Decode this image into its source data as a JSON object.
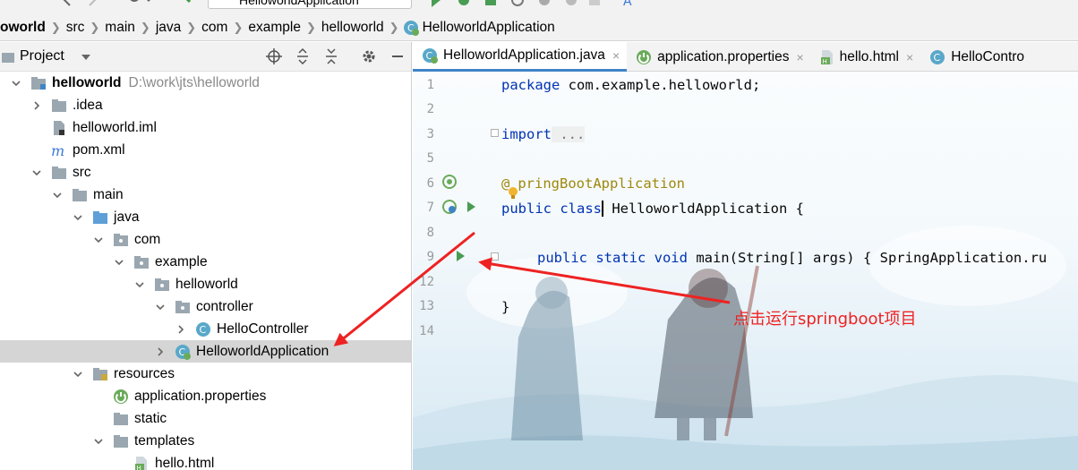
{
  "toolbar": {
    "run_config": "HelloworldApplication"
  },
  "breadcrumb": [
    "oworld",
    "src",
    "main",
    "java",
    "com",
    "example",
    "helloworld",
    "HelloworldApplication"
  ],
  "project_panel": {
    "title": "Project"
  },
  "tree": [
    {
      "label": "helloworld",
      "path": "D:\\work\\jts\\helloworld",
      "bold": true,
      "icon": "module-folder-icon",
      "expand": "down",
      "depth": 0
    },
    {
      "label": ".idea",
      "icon": "folder-icon",
      "expand": "right",
      "depth": 1
    },
    {
      "label": "helloworld.iml",
      "icon": "iml-file-icon",
      "expand": "none",
      "depth": 1
    },
    {
      "label": "pom.xml",
      "icon": "maven-icon",
      "expand": "none",
      "depth": 1
    },
    {
      "label": "src",
      "icon": "folder-icon",
      "expand": "down",
      "depth": 1
    },
    {
      "label": "main",
      "icon": "folder-icon",
      "expand": "down",
      "depth": 2
    },
    {
      "label": "java",
      "icon": "source-folder-icon",
      "expand": "down",
      "depth": 3
    },
    {
      "label": "com",
      "icon": "package-icon",
      "expand": "down",
      "depth": 4
    },
    {
      "label": "example",
      "icon": "package-icon",
      "expand": "down",
      "depth": 5
    },
    {
      "label": "helloworld",
      "icon": "package-icon",
      "expand": "down",
      "depth": 6
    },
    {
      "label": "controller",
      "icon": "package-icon",
      "expand": "down",
      "depth": 7
    },
    {
      "label": "HelloController",
      "icon": "class-icon",
      "expand": "right",
      "depth": 8
    },
    {
      "label": "HelloworldApplication",
      "icon": "spring-class-icon",
      "expand": "right",
      "depth": 7,
      "selected": true
    },
    {
      "label": "resources",
      "icon": "resources-folder-icon",
      "expand": "down",
      "depth": 3
    },
    {
      "label": "application.properties",
      "icon": "spring-properties-icon",
      "expand": "none",
      "depth": 4
    },
    {
      "label": "static",
      "icon": "folder-icon",
      "expand": "none",
      "depth": 4
    },
    {
      "label": "templates",
      "icon": "folder-icon",
      "expand": "down",
      "depth": 4
    },
    {
      "label": "hello.html",
      "icon": "html-file-icon",
      "expand": "none",
      "depth": 5
    }
  ],
  "tabs": [
    {
      "label": "HelloworldApplication.java",
      "icon": "spring-class-icon",
      "active": true,
      "close": "×"
    },
    {
      "label": "application.properties",
      "icon": "spring-properties-icon",
      "close": "×"
    },
    {
      "label": "hello.html",
      "icon": "html-file-icon",
      "close": "×"
    },
    {
      "label": "HelloContro",
      "icon": "class-icon",
      "close": ""
    }
  ],
  "code": {
    "line_numbers": [
      "1",
      "2",
      "3",
      "5",
      "6",
      "7",
      "8",
      "9",
      "12",
      "13",
      "14"
    ],
    "package_kw": "package",
    "package_name": " com.example.helloworld;",
    "import_kw": "import",
    "import_fold": " ...",
    "annotation_at": "@",
    "annotation_name": "pringBootApplication",
    "class_kw": "public class",
    "class_name": " HelloworldApplication {",
    "main_kw": "public static void",
    "main_rest": " main(String[] args) { SpringApplication.ru",
    "close_brace": "}"
  },
  "annotation": {
    "text": "点击运行springboot项目",
    "color": "#ee2222"
  }
}
